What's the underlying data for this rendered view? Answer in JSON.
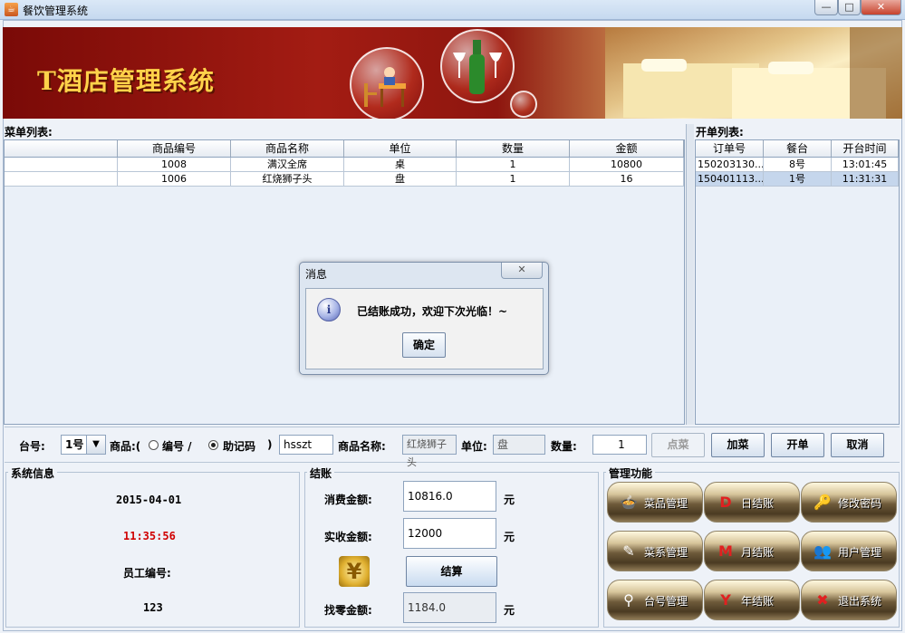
{
  "window": {
    "title": "餐饮管理系统",
    "min": "—",
    "max": "□",
    "close": "✕"
  },
  "banner": {
    "title": "T酒店管理系统"
  },
  "menu_list": {
    "label": "菜单列表:",
    "columns": [
      "",
      "商品编号",
      "商品名称",
      "单位",
      "数量",
      "金额"
    ],
    "rows": [
      [
        "",
        "1008",
        "满汉全席",
        "桌",
        "1",
        "10800"
      ],
      [
        "",
        "1006",
        "红烧狮子头",
        "盘",
        "1",
        "16"
      ]
    ]
  },
  "order_list": {
    "label": "开单列表:",
    "columns": [
      "订单号",
      "餐台",
      "开台时间"
    ],
    "rows": [
      [
        "150203130...",
        "8号",
        "13:01:45"
      ],
      [
        "150401113...",
        "1号",
        "11:31:31"
      ]
    ],
    "selected_index": 1
  },
  "controls": {
    "table_label": "台号:",
    "table_value": "1号",
    "goods_label": "商品:(",
    "radio_code": "编号 /",
    "radio_mnemonic": "助记码",
    "paren_close": ")",
    "mnemonic_value": "hsszt",
    "name_label": "商品名称:",
    "name_value": "红烧狮子头",
    "unit_label": "单位:",
    "unit_value": "盘",
    "qty_label": "数量:",
    "qty_value": "1",
    "btn_order": "点菜",
    "btn_add": "加菜",
    "btn_open": "开单",
    "btn_cancel": "取消"
  },
  "system_info": {
    "title": "系统信息",
    "date": "2015-04-01",
    "time": "11:35:56",
    "time_color": "#d00000",
    "emp_label": "员工编号:",
    "emp_value": "123"
  },
  "checkout": {
    "title": "结账",
    "consume_label": "消费金额:",
    "consume_value": "10816.0",
    "paid_label": "实收金额:",
    "paid_value": "12000",
    "change_label": "找零金额:",
    "change_value": "1184.0",
    "yuan": "元",
    "btn_settle": "结算"
  },
  "management": {
    "title": "管理功能",
    "buttons": [
      {
        "label": "菜品管理",
        "icon": "dish-icon"
      },
      {
        "label": "日结账",
        "icon": "daily-checkout-icon"
      },
      {
        "label": "修改密码",
        "icon": "key-icon"
      },
      {
        "label": "菜系管理",
        "icon": "cuisine-icon"
      },
      {
        "label": "月结账",
        "icon": "monthly-checkout-icon"
      },
      {
        "label": "用户管理",
        "icon": "users-icon"
      },
      {
        "label": "台号管理",
        "icon": "table-icon"
      },
      {
        "label": "年结账",
        "icon": "yearly-checkout-icon"
      },
      {
        "label": "退出系统",
        "icon": "exit-icon"
      }
    ]
  },
  "dialog": {
    "title": "消息",
    "message": "已结账成功，欢迎下次光临！~",
    "ok": "确定",
    "close": "✕",
    "info_glyph": "i"
  }
}
